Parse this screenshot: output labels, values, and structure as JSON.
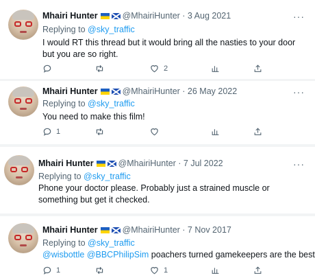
{
  "tweets": [
    {
      "name": "Mhairi Hunter",
      "handle": "@MhairiHunter",
      "date": "· 3 Aug 2021",
      "replying_prefix": "Replying to ",
      "replying_to": "@sky_traffic",
      "text": "I would RT this thread but it would bring all the nasties to your door but you are so right.",
      "reply_count": "",
      "retweet_count": "",
      "like_count": "2"
    },
    {
      "name": "Mhairi Hunter",
      "handle": "@MhairiHunter",
      "date": "· 26 May 2022",
      "replying_prefix": "Replying to ",
      "replying_to": "@sky_traffic",
      "text": "You need to make this film!",
      "reply_count": "1",
      "retweet_count": "",
      "like_count": ""
    },
    {
      "name": "Mhairi Hunter",
      "handle": "@MhairiHunter",
      "date": "· 7 Jul 2022",
      "replying_prefix": "Replying to ",
      "replying_to": "@sky_traffic",
      "text": "Phone your doctor please. Probably just a strained muscle or something but get it checked.",
      "reply_count": "",
      "retweet_count": "",
      "like_count": ""
    },
    {
      "name": "Mhairi Hunter",
      "handle": "@MhairiHunter",
      "date": "· 7 Nov 2017",
      "replying_prefix": "Replying to ",
      "replying_to": "@sky_traffic",
      "mention_1": "@wisbottle",
      "mention_2": "@BBCPhilipSim",
      "text_rest": " poachers turned gamekeepers are the best",
      "reply_count": "1",
      "retweet_count": "",
      "like_count": "1"
    }
  ],
  "icons": {
    "reply": "reply-icon",
    "retweet": "retweet-icon",
    "like": "like-icon",
    "analytics": "analytics-icon",
    "share": "share-icon",
    "more": "more-icon"
  },
  "more_label": "···",
  "colors": {
    "link": "#1d9bf0",
    "secondary": "#536471",
    "ua_blue": "#1c5fc2",
    "ua_yellow": "#ffd500",
    "saltire": "#1e4fb3"
  }
}
